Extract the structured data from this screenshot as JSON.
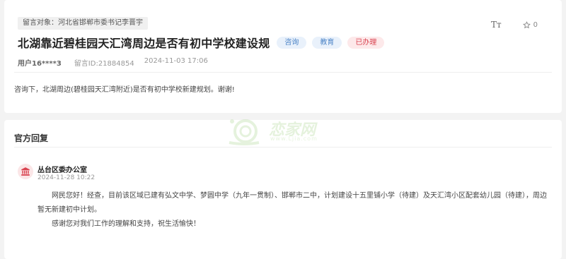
{
  "header": {
    "target_label": "留言对象：河北省邯郸市委书记李晋宇",
    "title": "北湖靠近碧桂园天汇湾周边是否有初中学校建设规",
    "tags": [
      "咨询",
      "教育",
      "已办理"
    ],
    "font_size_label": "Tт",
    "star_count": "0"
  },
  "meta": {
    "user": "用户16****3",
    "message_id": "留言ID:21884854",
    "datetime": "2024-11-03 17:06"
  },
  "content": "咨询下，北湖周边(碧桂园天汇湾附近)是否有初中学校新建规划。谢谢!",
  "reply": {
    "section_title": "官方回复",
    "org_name": "丛台区委办公室",
    "time": "2024-11-28 10:22",
    "paragraphs": [
      "网民您好！经查，目前该区域已建有弘文中学、梦圆中学（九年一贯制）、邯郸市二中，计划建设十五里铺小学（待建）及天汇湾小区配套幼儿园（待建），周边暂无新建初中计划。",
      "感谢您对我们工作的理解和支持，祝生活愉快！"
    ]
  },
  "watermark": {
    "text": "恋家网",
    "url": "www.Ljia.com"
  },
  "colors": {
    "tag_blue": "#4b83c6",
    "tag_red": "#d9424f",
    "icon_red": "#d9424f"
  }
}
